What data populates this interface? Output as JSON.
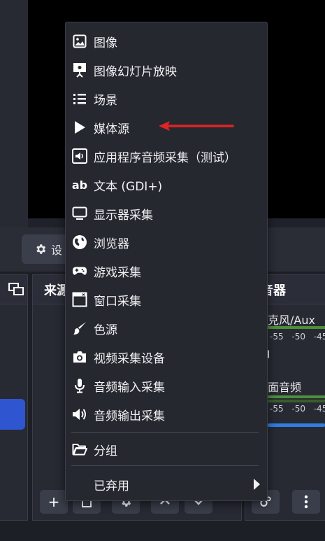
{
  "controls": {
    "settings_label": "设"
  },
  "docks": {
    "sources_title": "来源",
    "mixer_title": "混音器",
    "mixer": [
      {
        "label": "克风/Aux",
        "scale": "-55 -50 -45"
      },
      {
        "label": "面音频",
        "scale": "-55 -50 -45"
      }
    ]
  },
  "toolbar": {
    "add_label": "+"
  },
  "menu": {
    "items": [
      {
        "label": "图像",
        "icon": "image-icon"
      },
      {
        "label": "图像幻灯片放映",
        "icon": "slideshow-icon"
      },
      {
        "label": "场景",
        "icon": "list-icon"
      },
      {
        "label": "媒体源",
        "icon": "play-icon"
      },
      {
        "label": "应用程序音频采集（测试）",
        "icon": "app-audio-icon"
      },
      {
        "label": "文本 (GDI+)",
        "icon": "text-ab-icon"
      },
      {
        "label": "显示器采集",
        "icon": "monitor-icon"
      },
      {
        "label": "浏览器",
        "icon": "globe-icon"
      },
      {
        "label": "游戏采集",
        "icon": "gamepad-icon"
      },
      {
        "label": "窗口采集",
        "icon": "window-icon"
      },
      {
        "label": "色源",
        "icon": "brush-icon"
      },
      {
        "label": "视频采集设备",
        "icon": "camera-icon"
      },
      {
        "label": "音频输入采集",
        "icon": "microphone-icon"
      },
      {
        "label": "音频输出采集",
        "icon": "speaker-icon"
      },
      {
        "label": "分组",
        "icon": "folder-icon"
      },
      {
        "label": "已弃用",
        "icon": ""
      }
    ]
  },
  "colors": {
    "accent_blue": "#2f55d0",
    "annotation_red": "#e02424",
    "menu_bg": "#262830"
  }
}
